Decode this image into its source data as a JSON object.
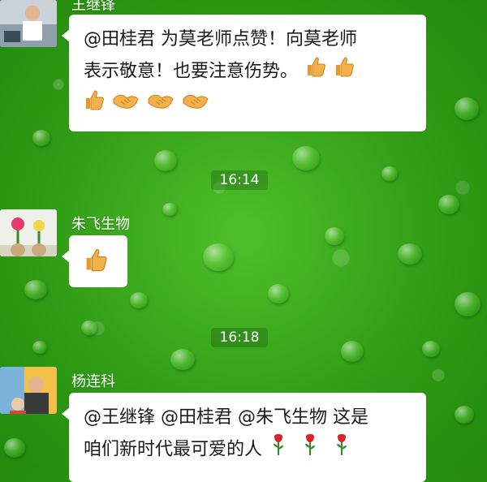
{
  "messages": [
    {
      "sender": "王继锋",
      "text_line1": "@田桂君 为莫老师点赞！向莫老师",
      "text_line2": "表示敬意！也要注意伤势。",
      "emojis_line2": [
        "thumbs-up-icon",
        "thumbs-up-icon"
      ],
      "emojis_line3": [
        "thumbs-up-icon",
        "handshake-icon",
        "handshake-icon",
        "handshake-icon"
      ]
    },
    {
      "sender": "朱飞生物",
      "emojis": [
        "thumbs-up-icon"
      ]
    },
    {
      "sender": "杨连科",
      "text_line1": "@王继锋 @田桂君 @朱飞生物 这是",
      "text_line2": "咱们新时代最可爱的人",
      "emojis_line2": [
        "rose-icon",
        "rose-icon",
        "rose-icon"
      ]
    }
  ],
  "timestamps": [
    "16:14",
    "16:18"
  ],
  "colors": {
    "background": "#2f9a15",
    "bubble": "#ffffff",
    "thumb": "#f3b14b",
    "rose": "#d8232a",
    "stem": "#2e8b2e"
  }
}
